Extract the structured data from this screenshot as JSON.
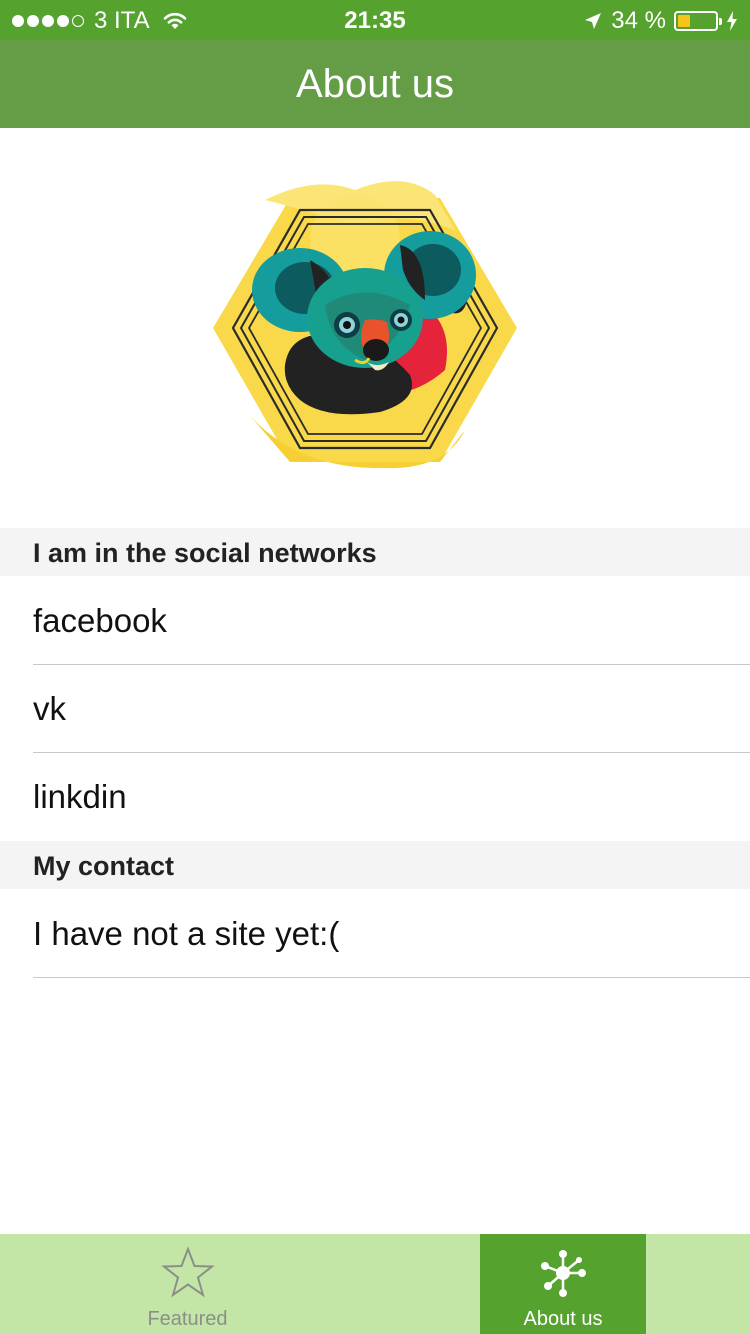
{
  "status_bar": {
    "carrier": "3 ITA",
    "time": "21:35",
    "battery_percent_text": "34 %",
    "battery_level": 0.34,
    "signal_bars": 4
  },
  "nav": {
    "title": "About us"
  },
  "sections": [
    {
      "header": "I am in the social networks",
      "rows": [
        "facebook",
        "vk",
        "linkdin"
      ]
    },
    {
      "header": "My contact",
      "rows": [
        "I have not a site yet:("
      ]
    }
  ],
  "tabs": [
    {
      "label": "Featured",
      "icon": "star-icon",
      "selected": false
    },
    {
      "label": "About us",
      "icon": "network-nodes-icon",
      "selected": true
    }
  ],
  "colors": {
    "status_bar": "#56a22f",
    "nav_bar": "#659d47",
    "tab_bar": "#c3e6a7",
    "tab_selected": "#56a22f"
  }
}
